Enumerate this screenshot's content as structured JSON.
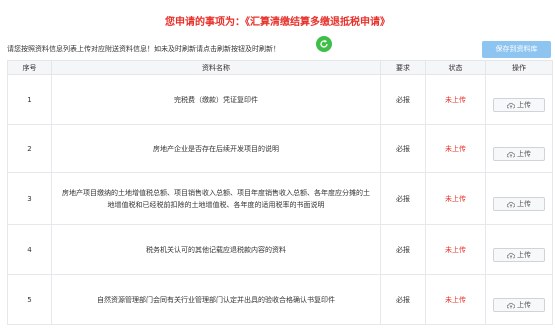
{
  "header": {
    "title": "您申请的事项为：《汇算清缴结算多缴退抵税申请》",
    "notice": "请您按照资料信息列表上传对应附送资料信息！如未及时刷新请点击刷新按钮及时刷新！",
    "save_label": "保存到资料库"
  },
  "table": {
    "columns": [
      "序号",
      "资料名称",
      "要求",
      "状态",
      "操作"
    ],
    "rows": [
      {
        "no": "1",
        "name": "完税费（缴款）凭证复印件",
        "req": "必报",
        "status": "未上传",
        "action": "上传"
      },
      {
        "no": "2",
        "name": "房地产企业是否存在后续开发项目的说明",
        "req": "必报",
        "status": "未上传",
        "action": "上传"
      },
      {
        "no": "3",
        "name": "房地产项目缴纳的土地增值税总额、项目销售收入总额、项目年度销售收入总额、各年度应分摊的土地增值税和已经税前扣除的土地增值税、各年度的适用税率的书面说明",
        "req": "必报",
        "status": "未上传",
        "action": "上传"
      },
      {
        "no": "4",
        "name": "税务机关认可的其他记载应退税款内容的资料",
        "req": "必报",
        "status": "未上传",
        "action": "上传"
      },
      {
        "no": "5",
        "name": "自然资源管理部门会同有关行业管理部门认定并出具的验收合格确认书复印件",
        "req": "必报",
        "status": "未上传",
        "action": "上传"
      }
    ]
  },
  "colors": {
    "accent": "#e8312a",
    "button": "#8ec4f0",
    "refresh": "#3fbf4a"
  },
  "icons": {
    "refresh": "refresh-icon",
    "upload": "cloud-upload-icon"
  }
}
